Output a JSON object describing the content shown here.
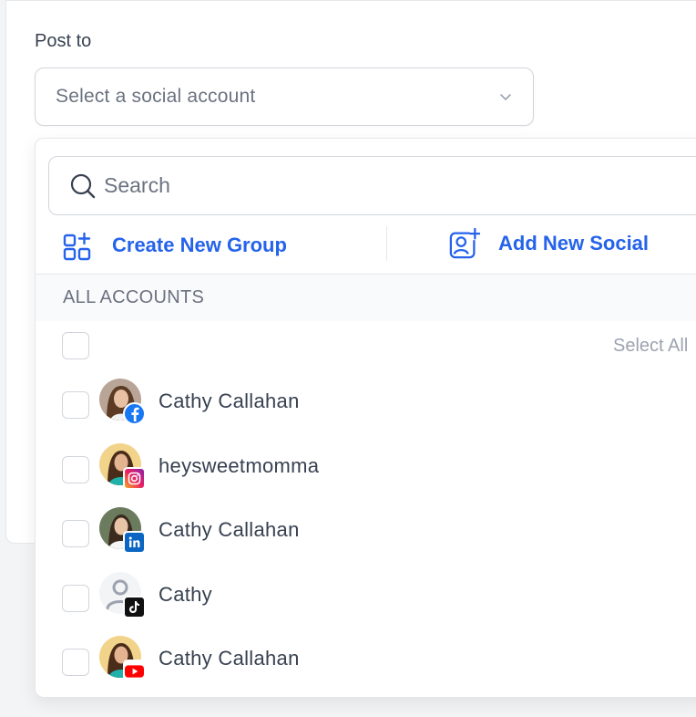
{
  "form": {
    "post_to_label": "Post to",
    "select_placeholder": "Select a social account"
  },
  "dropdown": {
    "search_placeholder": "Search",
    "create_group_label": "Create New Group",
    "add_social_label": "Add New Social",
    "section_title": "ALL ACCOUNTS",
    "select_all_label": "Select All",
    "accounts": [
      {
        "name": "Cathy Callahan",
        "network": "facebook-icon"
      },
      {
        "name": "heysweetmomma",
        "network": "instagram-icon"
      },
      {
        "name": "Cathy Callahan",
        "network": "linkedin-icon"
      },
      {
        "name": "Cathy",
        "network": "tiktok-icon"
      },
      {
        "name": "Cathy Callahan",
        "network": "youtube-icon"
      }
    ]
  },
  "colors": {
    "accent": "#2563eb",
    "facebook": "#1877f2",
    "linkedin": "#0a66c2",
    "tiktok": "#111111",
    "youtube": "#ff0000"
  }
}
